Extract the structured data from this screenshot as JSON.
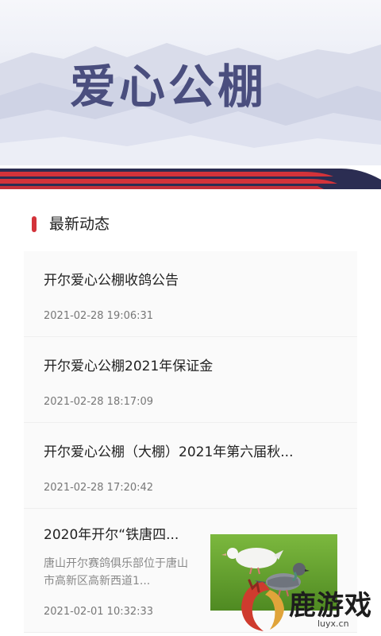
{
  "banner": {
    "title": "爱心公棚"
  },
  "section": {
    "title": "最新动态"
  },
  "news": [
    {
      "title": "开尔爱心公棚收鸽公告",
      "time": "2021-02-28 19:06:31"
    },
    {
      "title": "开尔爱心公棚2021年保证金",
      "time": "2021-02-28 18:17:09"
    },
    {
      "title": "开尔爱心公棚（大棚）2021年第六届秋...",
      "time": "2021-02-28 17:20:42"
    },
    {
      "title": "2020年开尔“铁唐四...",
      "desc": "唐山开尔赛鸽俱乐部位于唐山市高新区高新西道1...",
      "time": "2021-02-01 10:32:33"
    }
  ],
  "watermark": {
    "text": "鹿游戏",
    "url": "luyx.cn"
  },
  "colors": {
    "accent": "#d3333a",
    "banner_title": "#4a4e7e",
    "stripe_navy": "#2b2d52"
  }
}
